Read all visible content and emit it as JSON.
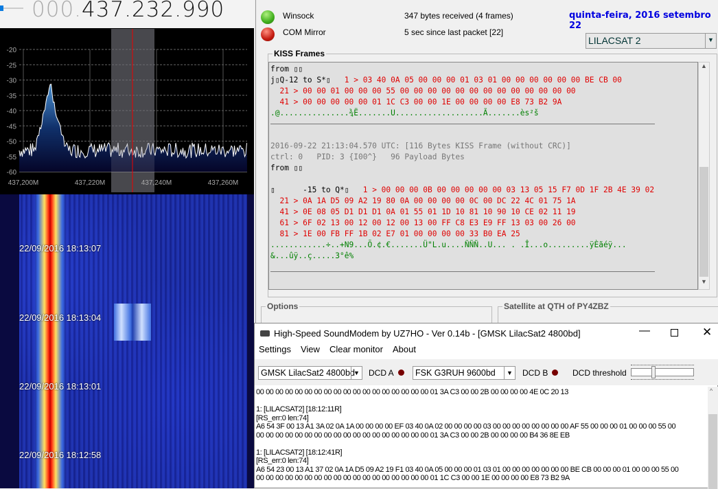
{
  "sdr": {
    "freq_dim": "000.",
    "freq_main": "437.232.990",
    "y_ticks": [
      "-20",
      "-25",
      "-30",
      "-35",
      "-40",
      "-45",
      "-50",
      "-55",
      "-60"
    ],
    "x_ticks": [
      "437,200M",
      "437,220M",
      "437,240M",
      "437,260M"
    ],
    "waterfall_times": [
      "22/09/2016 18:13:07",
      "22/09/2016 18:13:04",
      "22/09/2016 18:13:01",
      "22/09/2016 18:12:58"
    ]
  },
  "decoder": {
    "status": [
      {
        "name": "Winsock",
        "info": "347 bytes received (4 frames)",
        "color": "#3fae1c"
      },
      {
        "name": "COM Mirror",
        "info": "5 sec since last packet [22]",
        "color": "#c41a10"
      }
    ],
    "date": "quinta-feira, 2016 setembro 22",
    "satellite": "LILACSAT 2",
    "kiss_title": "KISS Frames",
    "frame1": {
      "from": "from ▯▯",
      "hdr": "j▯Q-12 to S*▯",
      "rows": [
        "   1 > 03 40 0A 05 00 00 00 01 03 01 00 00 00 00 00 00 BE CB 00",
        "  21 > 00 00 01 00 00 00 55 00 00 00 00 00 00 00 00 00 00 00 00 00",
        "  41 > 00 00 00 00 00 01 1C C3 00 00 1E 00 00 00 00 E8 73 B2 9A"
      ],
      "ascii": ".@...............¾Ë.......U...................Ã.......ès²š"
    },
    "frame2": {
      "ts": "2016-09-22 21:13:04.570 UTC: [116 Bytes KISS Frame (without CRC)]",
      "ctrl": "ctrl: 0   PID: 3 {I00^}   96 Payload Bytes",
      "from": "from ▯▯",
      "hdr": "▯      -15 to Q*▯",
      "rows": [
        "   1 > 00 00 00 0B 00 00 00 00 00 03 13 05 15 F7 0D 1F 2B 4E 39 02",
        "  21 > 0A 1A D5 09 A2 19 80 0A 00 00 00 00 0C 00 DC 22 4C 01 75 1A",
        "  41 > 0E 08 05 D1 D1 D1 0A 01 55 01 1D 10 81 10 90 10 CE 02 11 19",
        "  61 > 6F 02 13 00 12 00 12 00 13 00 FF C8 E3 E9 FF 13 03 00 26 00",
        "  81 > 1E 00 FB FF 1B 02 E7 01 00 00 00 00 33 B0 EA 25"
      ],
      "ascii": [
        "............÷..+N9...Õ.¢.€.......Ü\"L.u....ÑÑÑ..U... . .Î...o.........ÿÈãéÿ...",
        "&...ûÿ..ç.....3°ê%"
      ]
    },
    "options_title": "Options",
    "sat_title": "Satellite at QTH of PY4ZBZ"
  },
  "modem": {
    "title": "High-Speed SoundModem by UZ7HO - Ver 0.14b - [GMSK LilacSat2 4800bd]",
    "menu": [
      "Settings",
      "View",
      "Clear monitor",
      "About"
    ],
    "mode_a": "GMSK LilacSat2 4800bd",
    "dcd_a": "DCD A",
    "mode_b": "FSK G3RUH 9600bd",
    "dcd_b": "DCD B",
    "dcd_threshold": "DCD threshold",
    "monitor": [
      "00 00 00 00 00 00 00 00 00 00 00 00 00 00 00 00 00 00 01 3A C3 00 00 2B 00 00 00 00 4E 0C 20 13",
      "",
      "1: [LILACSAT2] [18:12:11R]",
      "[RS_err:0 len:74]",
      "A6 54 3F 00 13 A1 3A 02 0A 1A 00 00 00 00 EF 03 40 0A 02 00 00 00 00 03 00 00 00 00 00 00 00 00 AF 55 00 00 00 01 00 00 00 55 00",
      "00 00 00 00 00 00 00 00 00 00 00 00 00 00 00 00 00 00 01 3A C3 00 00 2B 00 00 00 00 B4 36 8E EB",
      "",
      "1: [LILACSAT2] [18:12:41R]",
      "[RS_err:0 len:74]",
      "A6 54 23 00 13 A1 37 02 0A 1A D5 09 A2 19 F1 03 40 0A 05 00 00 00 01 03 01 00 00 00 00 00 00 00 BE CB 00 00 00 01 00 00 00 55 00",
      "00 00 00 00 00 00 00 00 00 00 00 00 00 00 00 00 00 00 01 1C C3 00 00 1E 00 00 00 00 E8 73 B2 9A"
    ]
  }
}
